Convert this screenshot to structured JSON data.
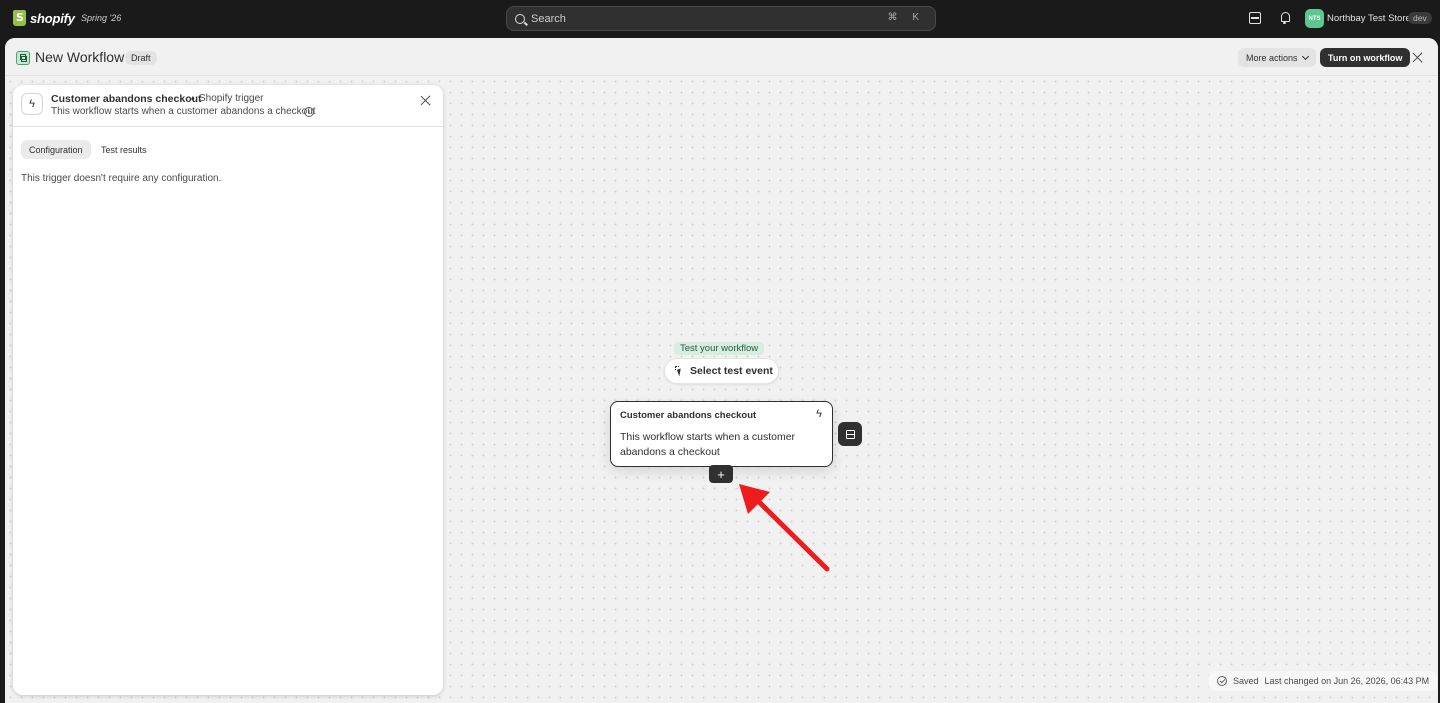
{
  "topbar": {
    "brand": "shopify",
    "edition": "Spring '26",
    "search_placeholder": "Search",
    "search_shortcut": "⌘ K",
    "store_initials": "NTS",
    "store_name": "Northbay Test Store",
    "store_badge": "dev"
  },
  "header": {
    "title": "New Workflow",
    "badge": "Draft",
    "more_actions": "More actions",
    "turn_on": "Turn on workflow"
  },
  "panel": {
    "title": "Customer abandons checkout",
    "separator": "•",
    "subtitle": "Shopify trigger",
    "description": "This workflow starts when a customer abandons a checkout",
    "info_glyph": "i",
    "tabs": [
      {
        "label": "Configuration",
        "active": true
      },
      {
        "label": "Test results",
        "active": false
      }
    ],
    "body_text": "This trigger doesn't require any configuration."
  },
  "canvas": {
    "test_label": "Test your workflow",
    "select_button": "Select test event",
    "card_title": "Customer abandons checkout",
    "card_bolt": "ϟ",
    "card_description": "This workflow starts when a customer abandons a checkout",
    "plus_glyph": "+"
  },
  "status": {
    "saved": "Saved",
    "last_changed": "Last changed on Jun 26, 2026, 06:43 PM"
  },
  "colors": {
    "arrow": "#ee1c1c",
    "accent_green": "#5ec68f",
    "dark_button": "#303030"
  }
}
